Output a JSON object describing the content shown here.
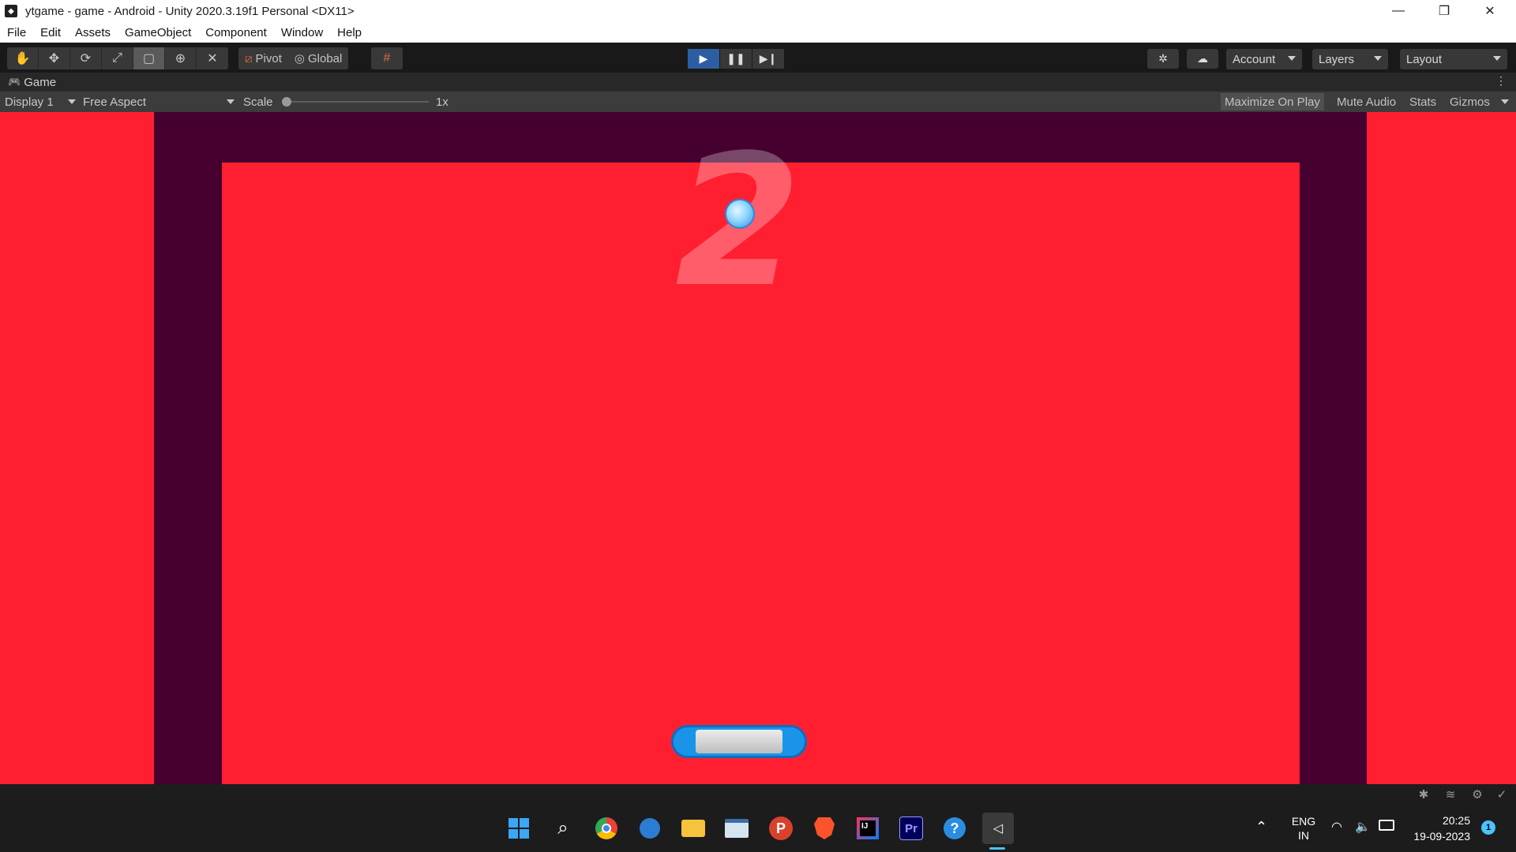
{
  "window": {
    "title": "ytgame - game - Android - Unity 2020.3.19f1 Personal <DX11>",
    "minimize": "—",
    "restore": "❐",
    "close": "✕"
  },
  "menu": [
    "File",
    "Edit",
    "Assets",
    "GameObject",
    "Component",
    "Window",
    "Help"
  ],
  "toolbar": {
    "pivot_label": "Pivot",
    "global_label": "Global",
    "account_label": "Account",
    "layers_label": "Layers",
    "layout_label": "Layout"
  },
  "game_tab": {
    "label": "Game"
  },
  "game_bar": {
    "display": "Display 1",
    "aspect": "Free Aspect",
    "scale_label": "Scale",
    "scale_value": "1x",
    "maximize_on_play": "Maximize On Play",
    "mute_audio": "Mute Audio",
    "stats": "Stats",
    "gizmos": "Gizmos"
  },
  "game_view": {
    "score": "2",
    "colors": {
      "background": "#ff1f30",
      "frame": "#450030",
      "ball": "#8fd6fb",
      "paddle": "#1a94e8"
    }
  },
  "taskbar": {
    "icons": [
      "windows-start-icon",
      "search-icon",
      "chrome-icon",
      "word-icon",
      "file-explorer-icon",
      "terminal-icon",
      "p-app-icon",
      "brave-icon",
      "intellij-icon",
      "premiere-pro-icon",
      "help-icon",
      "unity-icon"
    ],
    "premiere_label": "Pr",
    "p_label": "P",
    "ij_label": "IJ",
    "lang_line1": "ENG",
    "lang_line2": "IN",
    "time": "20:25",
    "date": "19-09-2023",
    "notification_count": "1"
  }
}
